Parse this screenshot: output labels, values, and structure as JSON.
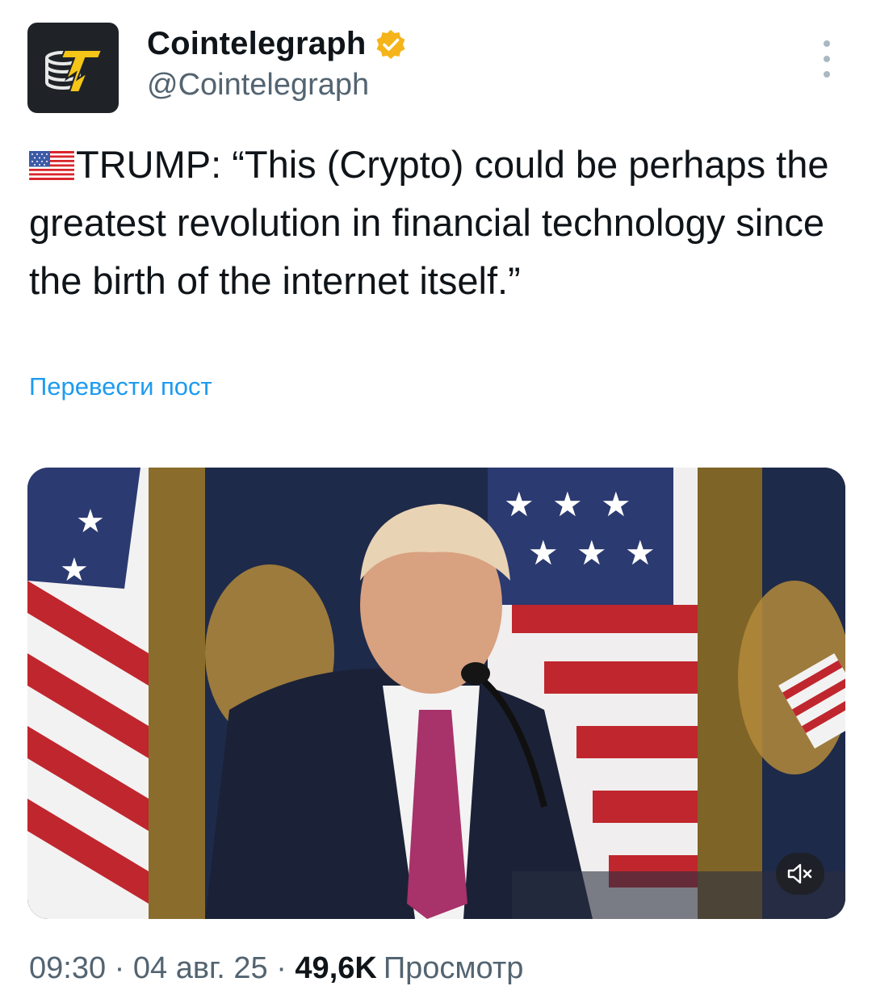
{
  "author": {
    "display_name": "Cointelegraph",
    "handle": "@Cointelegraph",
    "verified": true,
    "avatar_icon": "cointelegraph-logo-icon",
    "verified_icon": "verified-badge-icon",
    "colors": {
      "avatar_bg": "#1f2327",
      "logo": "#f5c518",
      "verified_badge": "#f4b41a"
    }
  },
  "menu": {
    "icon": "more-vertical-icon"
  },
  "tweet": {
    "flag_emoji": "us-flag-icon",
    "text": "TRUMP: “This (Crypto) could be perhaps the greatest revolution in financial technology since the birth of the internet itself.”"
  },
  "translate_label": "Перевести пост",
  "media": {
    "type": "video",
    "mute_icon": "volume-muted-icon"
  },
  "meta": {
    "time": "09:30",
    "separator": "·",
    "date": "04 авг. 25",
    "views_count": "49,6K",
    "views_label": "Просмотр"
  },
  "colors": {
    "link": "#1d9bf0",
    "secondary_text": "#536471",
    "primary_text": "#0f1419"
  }
}
